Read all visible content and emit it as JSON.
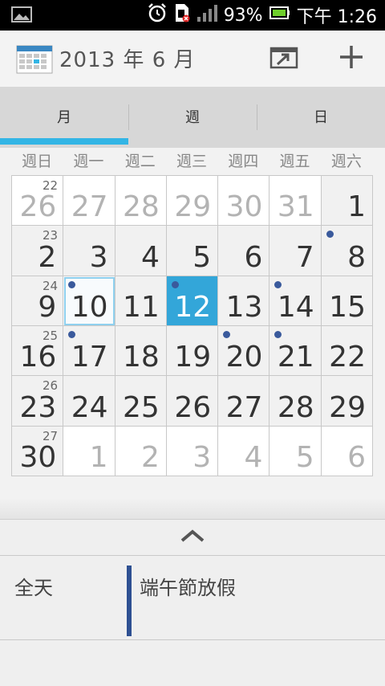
{
  "status_bar": {
    "battery_percent": "93%",
    "time": "下午 1:26",
    "icons": [
      "image-icon",
      "alarm-icon",
      "no-sim-icon",
      "signal-icon",
      "battery-icon"
    ]
  },
  "action_bar": {
    "title": "2013 年 6 月",
    "icons": [
      "calendar-app-icon",
      "go-to-today-icon",
      "add-event-icon"
    ]
  },
  "tabs": [
    {
      "label": "月",
      "selected": true
    },
    {
      "label": "週",
      "selected": false
    },
    {
      "label": "日",
      "selected": false
    }
  ],
  "weekdays": [
    "週日",
    "週一",
    "週二",
    "週三",
    "週四",
    "週五",
    "週六"
  ],
  "weeks": [
    {
      "week_no": "22",
      "days": [
        {
          "d": "26",
          "other": true,
          "dot": false
        },
        {
          "d": "27",
          "other": true,
          "dot": false
        },
        {
          "d": "28",
          "other": true,
          "dot": false
        },
        {
          "d": "29",
          "other": true,
          "dot": false
        },
        {
          "d": "30",
          "other": true,
          "dot": false
        },
        {
          "d": "31",
          "other": true,
          "dot": false
        },
        {
          "d": "1",
          "other": false,
          "dot": false
        }
      ]
    },
    {
      "week_no": "23",
      "days": [
        {
          "d": "2",
          "other": false,
          "dot": false
        },
        {
          "d": "3",
          "other": false,
          "dot": false
        },
        {
          "d": "4",
          "other": false,
          "dot": false
        },
        {
          "d": "5",
          "other": false,
          "dot": false
        },
        {
          "d": "6",
          "other": false,
          "dot": false
        },
        {
          "d": "7",
          "other": false,
          "dot": false
        },
        {
          "d": "8",
          "other": false,
          "dot": true
        }
      ]
    },
    {
      "week_no": "24",
      "days": [
        {
          "d": "9",
          "other": false,
          "dot": false
        },
        {
          "d": "10",
          "other": false,
          "dot": true,
          "today": true
        },
        {
          "d": "11",
          "other": false,
          "dot": false
        },
        {
          "d": "12",
          "other": false,
          "dot": true,
          "selected": true
        },
        {
          "d": "13",
          "other": false,
          "dot": false
        },
        {
          "d": "14",
          "other": false,
          "dot": true
        },
        {
          "d": "15",
          "other": false,
          "dot": false
        }
      ]
    },
    {
      "week_no": "25",
      "days": [
        {
          "d": "16",
          "other": false,
          "dot": false
        },
        {
          "d": "17",
          "other": false,
          "dot": true
        },
        {
          "d": "18",
          "other": false,
          "dot": false
        },
        {
          "d": "19",
          "other": false,
          "dot": false
        },
        {
          "d": "20",
          "other": false,
          "dot": true
        },
        {
          "d": "21",
          "other": false,
          "dot": true
        },
        {
          "d": "22",
          "other": false,
          "dot": false
        }
      ]
    },
    {
      "week_no": "26",
      "days": [
        {
          "d": "23",
          "other": false,
          "dot": false
        },
        {
          "d": "24",
          "other": false,
          "dot": false
        },
        {
          "d": "25",
          "other": false,
          "dot": false
        },
        {
          "d": "26",
          "other": false,
          "dot": false
        },
        {
          "d": "27",
          "other": false,
          "dot": false
        },
        {
          "d": "28",
          "other": false,
          "dot": false
        },
        {
          "d": "29",
          "other": false,
          "dot": false
        }
      ]
    },
    {
      "week_no": "27",
      "days": [
        {
          "d": "30",
          "other": false,
          "dot": false
        },
        {
          "d": "1",
          "other": true,
          "dot": false
        },
        {
          "d": "2",
          "other": true,
          "dot": false
        },
        {
          "d": "3",
          "other": true,
          "dot": false
        },
        {
          "d": "4",
          "other": true,
          "dot": false
        },
        {
          "d": "5",
          "other": true,
          "dot": false
        },
        {
          "d": "6",
          "other": true,
          "dot": false
        }
      ]
    }
  ],
  "events": {
    "collapse_icon": "chevron-up-icon",
    "all_day_label": "全天",
    "items": [
      {
        "title": "端午節放假",
        "color": "#2e5092"
      }
    ]
  },
  "colors": {
    "accent": "#33b5e5",
    "selected_day": "#33a6d9",
    "event_dot": "#3a5a9c"
  }
}
